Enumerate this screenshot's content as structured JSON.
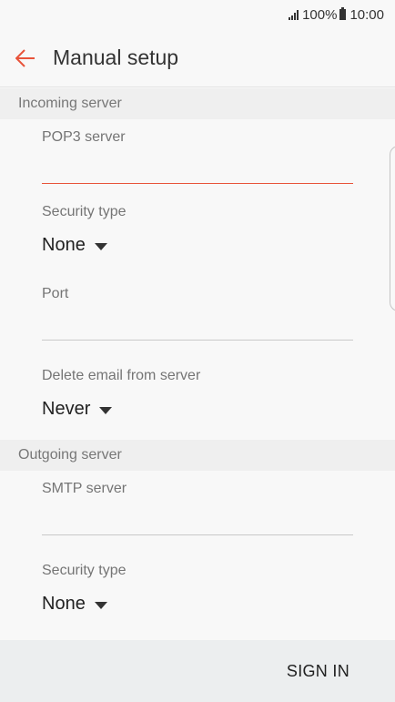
{
  "status_bar": {
    "battery": "100%",
    "time": "10:00",
    "signal_icon": "signal-icon",
    "battery_icon": "battery-icon"
  },
  "header": {
    "back_icon": "arrow-back-icon",
    "title": "Manual setup",
    "accent_color": "#e8533a"
  },
  "incoming": {
    "section_title": "Incoming server",
    "pop3_label": "POP3 server",
    "pop3_value": "",
    "security_label": "Security type",
    "security_value": "None",
    "port_label": "Port",
    "port_value": "",
    "delete_label": "Delete email from server",
    "delete_value": "Never"
  },
  "outgoing": {
    "section_title": "Outgoing server",
    "smtp_label": "SMTP server",
    "smtp_value": "",
    "security_label": "Security type",
    "security_value": "None"
  },
  "footer": {
    "sign_in_label": "SIGN IN"
  }
}
